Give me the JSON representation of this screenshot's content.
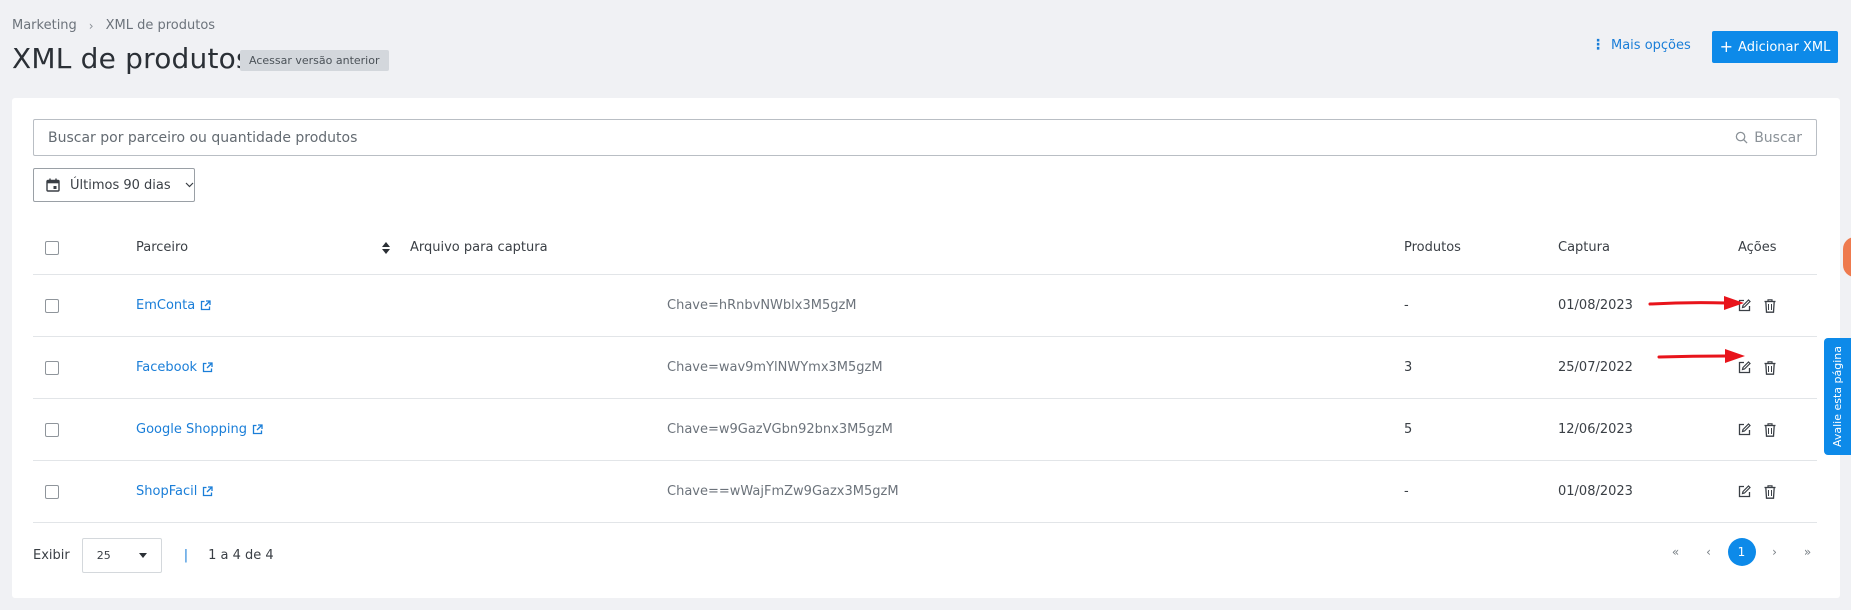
{
  "breadcrumb": {
    "items": [
      "Marketing",
      "XML de produtos"
    ],
    "separator": "›"
  },
  "page": {
    "title": "XML de produtos",
    "badge": "Acessar versão anterior"
  },
  "header": {
    "more_options": "Mais opções",
    "add_button": "Adicionar XML"
  },
  "search": {
    "placeholder": "Buscar por parceiro ou quantidade produtos",
    "value": "",
    "action_label": "Buscar"
  },
  "date_filter": {
    "label": "Últimos 90 dias"
  },
  "table": {
    "headers": {
      "partner": "Parceiro",
      "file": "Arquivo para captura",
      "products": "Produtos",
      "capture": "Captura",
      "actions": "Ações"
    },
    "rows": [
      {
        "partner": "EmConta",
        "key": "Chave=hRnbvNWblx3M5gzM",
        "products": "-",
        "capture": "01/08/2023"
      },
      {
        "partner": "Facebook",
        "key": "Chave=wav9mYlNWYmx3M5gzM",
        "products": "3",
        "capture": "25/07/2022"
      },
      {
        "partner": "Google Shopping",
        "key": "Chave=w9GazVGbn92bnx3M5gzM",
        "products": "5",
        "capture": "12/06/2023"
      },
      {
        "partner": "ShopFacil",
        "key": "Chave==wWajFmZw9Gazx3M5gzM",
        "products": "-",
        "capture": "01/08/2023"
      }
    ]
  },
  "footer": {
    "show_label": "Exibir",
    "page_size": "25",
    "separator": "|",
    "range_text": "1 a 4 de 4"
  },
  "pagination": {
    "first": "«",
    "prev": "‹",
    "current": "1",
    "next": "›",
    "last": "»"
  },
  "feedback_tab": {
    "label": "Avalie esta página"
  },
  "colors": {
    "accent": "#0d8ae9",
    "link": "#1a7ed8",
    "annotation_arrow": "#e8141b",
    "orange": "#ee7a4e"
  }
}
